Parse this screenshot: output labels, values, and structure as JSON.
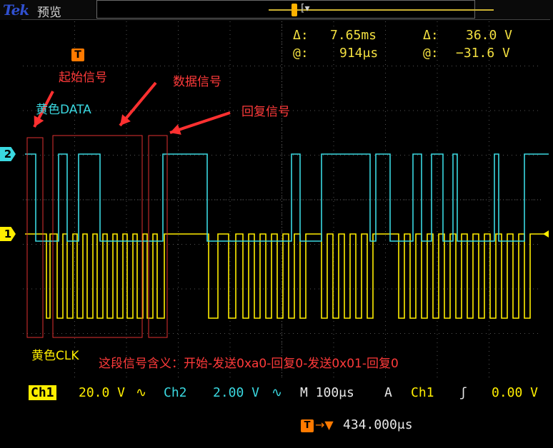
{
  "header": {
    "brand": "Tek",
    "mode": "预览"
  },
  "cursors": {
    "delta_time_label": "Δ:",
    "delta_time": "7.65ms",
    "at_time_label": "@:",
    "at_time": "914μs",
    "delta_volt_label": "Δ:",
    "delta_volt": "36.0 V",
    "at_volt_label": "@:",
    "at_volt": "−31.6 V"
  },
  "annotations": {
    "start_signal": "起始信号",
    "data_signal": "数据信号",
    "reply_signal": "回复信号",
    "yellow_data": "黄色DATA",
    "yellow_clk": "黄色CLK",
    "meaning": "这段信号含义：开始-发送0xa0-回复0-发送0x01-回复0"
  },
  "channel_markers": {
    "ch2": "2",
    "ch1": "1",
    "trigger": "T"
  },
  "status": {
    "ch1_label": "Ch1",
    "ch1_scale": "20.0 V",
    "ch1_coupling": "∿",
    "ch2_label": "Ch2",
    "ch2_scale": "2.00 V",
    "ch2_coupling": "∿",
    "timebase": "M 100μs",
    "acq_mode": "A",
    "trigger_source": "Ch1",
    "trigger_slope": "ʃ",
    "trigger_level": "0.00 V",
    "trigger_icon": "T",
    "position_arrow": "→▼",
    "position": "434.000μs"
  },
  "colors": {
    "ch1": "#ffee00",
    "ch2": "#3ad8e0",
    "annotation": "#ff3a3a",
    "trigger": "#ff7a00"
  }
}
